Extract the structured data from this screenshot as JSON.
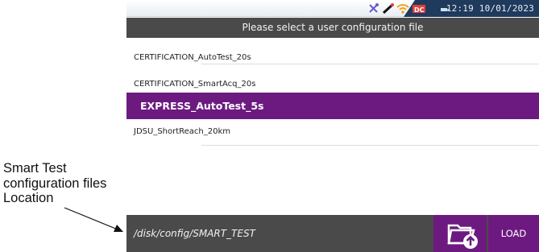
{
  "callout": {
    "line1": "Smart Test",
    "line2": "configuration files",
    "line3": "Location"
  },
  "statusbar": {
    "time": "12:19",
    "date": "10/01/2023",
    "icons": [
      "tools-icon",
      "probe-icon",
      "wifi-icon",
      "dc-battery-icon",
      "network-icon"
    ],
    "accent": "#1f3a5c"
  },
  "header": {
    "title": "Please select a user configuration file"
  },
  "files": [
    {
      "name": "CERTIFICATION_AutoTest_20s",
      "selected": false
    },
    {
      "name": "CERTIFICATION_SmartAcq_20s",
      "selected": false
    },
    {
      "name": "EXPRESS_AutoTest_5s",
      "selected": true
    },
    {
      "name": "JDSU_ShortReach_20km",
      "selected": false
    }
  ],
  "bottombar": {
    "path": "/disk/config/SMART_TEST",
    "folder_icon": "folder-upload-icon",
    "load_label": "LOAD"
  },
  "colors": {
    "selection": "#6c1a80",
    "bar": "#4a4a4a"
  }
}
